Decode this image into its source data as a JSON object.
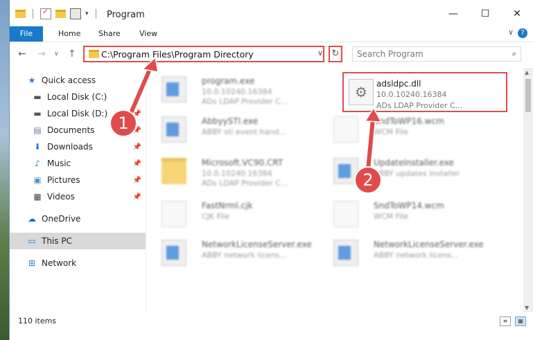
{
  "window": {
    "title": "Program",
    "controls": {
      "minimize": "—",
      "maximize": "☐",
      "close": "✕"
    }
  },
  "ribbon": {
    "tabs": [
      "File",
      "Home",
      "Share",
      "View"
    ],
    "help": "?"
  },
  "nav": {
    "back": "←",
    "forward": "→",
    "recent": "∨",
    "up": "↑",
    "address": "C:\\Program Files\\Program Directory",
    "refresh": "↻",
    "search_placeholder": "Search Program"
  },
  "sidebar": {
    "items": [
      {
        "label": "Quick access",
        "icon": "star-icon",
        "pinned": false
      },
      {
        "label": "Local Disk (C:)",
        "icon": "drive-icon",
        "pinned": true
      },
      {
        "label": "Local Disk (D:)",
        "icon": "drive-icon",
        "pinned": true
      },
      {
        "label": "Documents",
        "icon": "documents-icon",
        "pinned": true
      },
      {
        "label": "Downloads",
        "icon": "download-icon",
        "pinned": true
      },
      {
        "label": "Music",
        "icon": "music-icon",
        "pinned": true
      },
      {
        "label": "Pictures",
        "icon": "pictures-icon",
        "pinned": true
      },
      {
        "label": "Videos",
        "icon": "videos-icon",
        "pinned": true
      },
      {
        "label": "OneDrive",
        "icon": "cloud-icon",
        "pinned": false
      },
      {
        "label": "This PC",
        "icon": "computer-icon",
        "pinned": false,
        "selected": true
      },
      {
        "label": "Network",
        "icon": "network-icon",
        "pinned": false
      }
    ]
  },
  "files": [
    {
      "name": "program.exe",
      "line1": "10.0.10240.16384",
      "line2": "ADs LDAP Provider C...",
      "icon": "installer-icon"
    },
    {
      "name": "adsldpc.dll",
      "line1": "10.0.10240.16384",
      "line2": "ADs LDAP Provider C...",
      "icon": "dll-gear-icon"
    },
    {
      "name": "AbbyySTI.exe",
      "line1": "ABBY sti event hand...",
      "line2": "",
      "icon": "app-icon"
    },
    {
      "name": "SndToWP16.wcm",
      "line1": "WCM File",
      "line2": "",
      "icon": "document-icon"
    },
    {
      "name": "Microsoft.VC90.CRT",
      "line1": "10.0.10240.16384",
      "line2": "ADs LDAP Provider C...",
      "icon": "folder-icon"
    },
    {
      "name": "UpdateInstaller.exe",
      "line1": "ABBY updates installer",
      "line2": "",
      "icon": "app-icon"
    },
    {
      "name": "FastNrml.cjk",
      "line1": "CJK File",
      "line2": "",
      "icon": "document-icon"
    },
    {
      "name": "SndToWP14.wcm",
      "line1": "WCM File",
      "line2": "",
      "icon": "document-icon"
    },
    {
      "name": "NetworkLicenseServer.exe",
      "line1": "ABBY network licens...",
      "line2": "",
      "icon": "app-icon"
    },
    {
      "name": "NetworkLicenseServer.exe",
      "line1": "ABBY network licens...",
      "line2": "",
      "icon": "app-icon"
    }
  ],
  "status": {
    "count": "110 items"
  },
  "annotations": {
    "step1": "1",
    "step2": "2"
  },
  "colors": {
    "accent": "#1979ca",
    "highlight": "#e04b4b"
  }
}
